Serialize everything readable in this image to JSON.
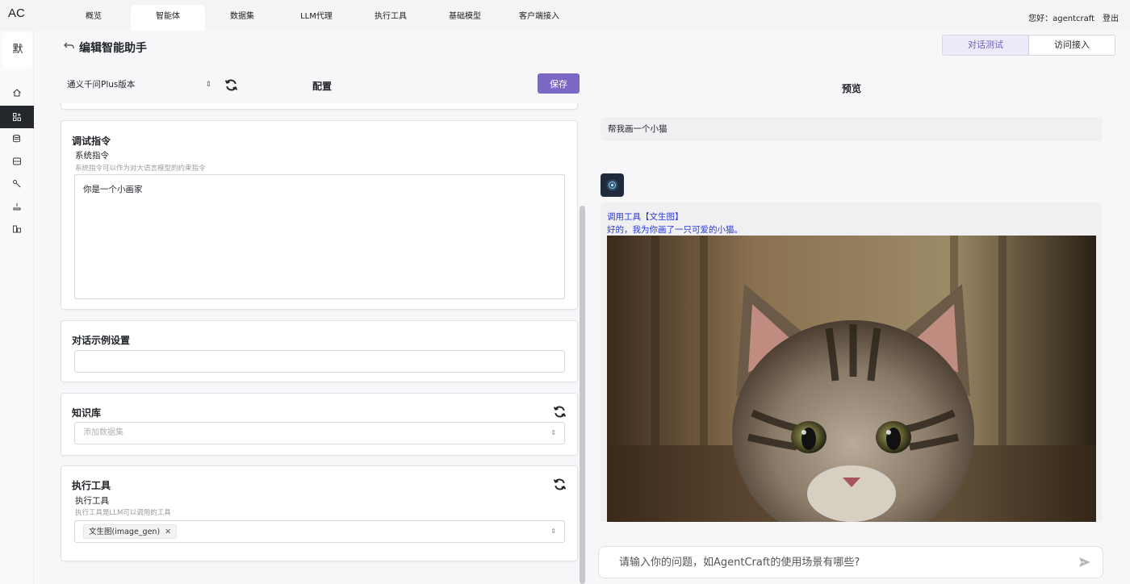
{
  "app": {
    "logo": "AC"
  },
  "nav": {
    "items": [
      {
        "label": "概览"
      },
      {
        "label": "智能体"
      },
      {
        "label": "数据集"
      },
      {
        "label": "LLM代理"
      },
      {
        "label": "执行工具"
      },
      {
        "label": "基础模型"
      },
      {
        "label": "客户端接入"
      }
    ],
    "active": "智能体"
  },
  "user": {
    "greeting": "您好：agentcraft",
    "logout": "登出"
  },
  "sidebar": {
    "avatar": "默",
    "icons": [
      "home-icon",
      "apps-icon",
      "database-add-icon",
      "storage-icon",
      "tool-icon",
      "deploy-icon",
      "client-icon"
    ],
    "active_index": 1
  },
  "page": {
    "title": "编辑智能助手"
  },
  "tabs": [
    {
      "label": "对话测试"
    },
    {
      "label": "访问接入"
    }
  ],
  "config": {
    "model_select": "通义千问Plus版本",
    "title": "配置",
    "save_label": "保存",
    "instructions": {
      "title": "调试指令",
      "label": "系统指令",
      "hint": "系统指令可以作为对大语言模型的约束指令",
      "value": "你是一个小画家"
    },
    "examples": {
      "title": "对话示例设置",
      "value": ""
    },
    "knowledge": {
      "title": "知识库",
      "placeholder": "添加数据集"
    },
    "tools": {
      "title": "执行工具",
      "label": "执行工具",
      "hint": "执行工具是LLM可以调用的工具",
      "selected": [
        "文生图(image_gen)"
      ]
    }
  },
  "preview": {
    "title": "预览",
    "user_message": "帮我画一个小猫",
    "bot_line1": "调用工具【文生图】",
    "bot_line2": "好的，我为你画了一只可爱的小猫。",
    "input_placeholder": "请输入你的问题，如AgentCraft的使用场景有哪些?"
  },
  "colors": {
    "accent": "#7a68c4",
    "tool_text": "#2a39d6",
    "sidebar_active": "#24272b"
  }
}
